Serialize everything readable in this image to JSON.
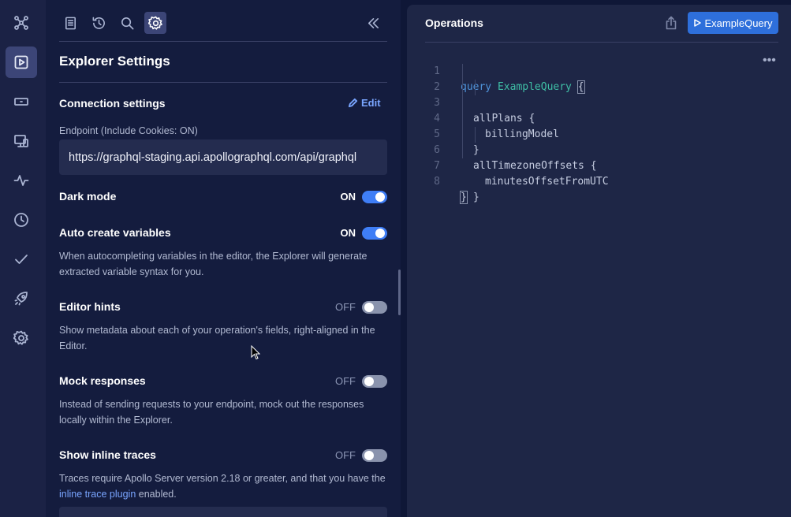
{
  "rail": {
    "icons": [
      "graph-icon",
      "explorer-play-icon",
      "schema-card-icon",
      "monitor-icon",
      "pulse-icon",
      "clock-icon",
      "check-icon",
      "rocket-icon",
      "settings-gear-icon"
    ]
  },
  "toolbar": {
    "icons": [
      "document-icon",
      "history-icon",
      "search-icon",
      "settings-icon",
      "collapse-icon"
    ]
  },
  "panel": {
    "title": "Explorer Settings",
    "connection": {
      "heading": "Connection settings",
      "edit_label": "Edit",
      "endpoint_label": "Endpoint (Include Cookies: ON)",
      "endpoint_value": "https://graphql-staging.api.apollographql.com/api/graphql"
    },
    "settings": [
      {
        "label": "Dark mode",
        "state": "ON",
        "on": true,
        "description": ""
      },
      {
        "label": "Auto create variables",
        "state": "ON",
        "on": true,
        "description": "When autocompleting variables in the editor, the Explorer will generate extracted variable syntax for you."
      },
      {
        "label": "Editor hints",
        "state": "OFF",
        "on": false,
        "description": "Show metadata about each of your operation's fields, right-aligned in the Editor."
      },
      {
        "label": "Mock responses",
        "state": "OFF",
        "on": false,
        "description": "Instead of sending requests to your endpoint, mock out the responses locally within the Explorer."
      },
      {
        "label": "Show inline traces",
        "state": "OFF",
        "on": false,
        "description_prefix": "Traces require Apollo Server version 2.18 or greater, and that you have the ",
        "description_link": "inline trace plugin",
        "description_suffix": " enabled."
      }
    ]
  },
  "editor": {
    "title": "Operations",
    "run_label": "ExampleQuery",
    "more_label": "•••",
    "lines": [
      {
        "n": "1",
        "text": "query ExampleQuery {"
      },
      {
        "n": "2",
        "text": "allPlans {"
      },
      {
        "n": "3",
        "text": "billingModel"
      },
      {
        "n": "4",
        "text": "}"
      },
      {
        "n": "5",
        "text": "allTimezoneOffsets {"
      },
      {
        "n": "6",
        "text": "minutesOffsetFromUTC"
      },
      {
        "n": "7",
        "text": "}"
      },
      {
        "n": "8",
        "text": "}"
      }
    ]
  },
  "colors": {
    "accent": "#3f7ef6",
    "background": "#0f1737",
    "panel": "#141c3e",
    "editor": "#1e2646"
  }
}
